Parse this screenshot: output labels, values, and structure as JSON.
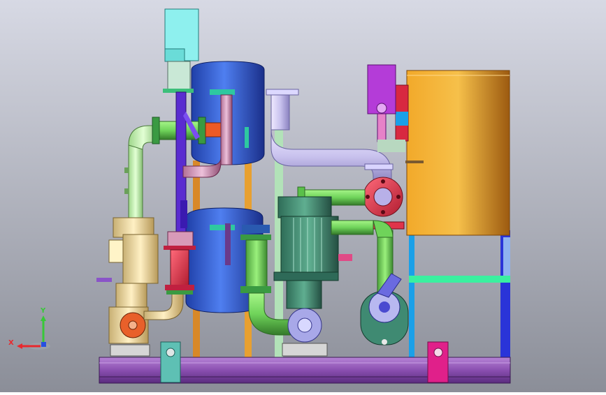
{
  "viewport": {
    "background_top": "#d7d9e4",
    "background_bottom": "#8b8e98"
  },
  "axes": {
    "x_label": "X",
    "y_label": "Y",
    "x_color": "#e8282d",
    "y_color": "#38c838",
    "z_color": "#2850e0"
  },
  "colors": {
    "tank_blue": "#3a63d6",
    "storage_tank_orange": "#e39a1f",
    "frame_purple": "#8a4fb0",
    "motor_cyan": "#8ef0ee",
    "pump_motor_green": "#3f8a72",
    "flange_red": "#e0344a",
    "pipe_lavender": "#c9c2ee",
    "pipe_green": "#6fd35a",
    "pipe_pink": "#d39fc0",
    "valve_magenta": "#b43cd8",
    "pump_tan": "#ecd9a0"
  }
}
